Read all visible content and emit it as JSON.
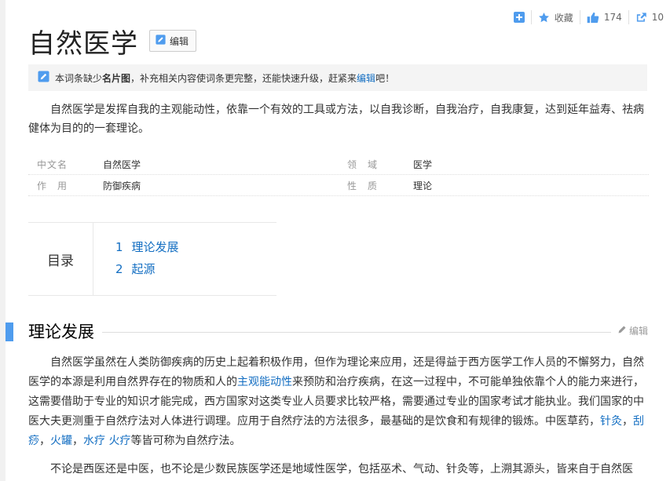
{
  "top_actions": {
    "favorite_label": "收藏",
    "like_count": "174",
    "share_count": "10"
  },
  "title": "自然医学",
  "edit_label": "编辑",
  "notice": {
    "pre": "本词条缺少",
    "bold": "名片图",
    "mid": "，补充相关内容使词条更完整，还能快速升级，赶紧来",
    "link": "编辑",
    "post": "吧！"
  },
  "summary": "自然医学是发挥自我的主观能动性，依靠一个有效的工具或方法，以自我诊断，自我治疗，自我康复，达到延年益寿、祛病健体为目的的一套理论。",
  "basic_info": {
    "rows": [
      {
        "name1": "中文名",
        "value1": "自然医学",
        "name2": "领　域",
        "value2": "医学"
      },
      {
        "name1": "作　用",
        "value1": "防御疾病",
        "name2": "性　质",
        "value2": "理论"
      }
    ]
  },
  "catalog": {
    "title": "目录",
    "items": [
      {
        "index": "1",
        "label": "理论发展"
      },
      {
        "index": "2",
        "label": "起源"
      }
    ]
  },
  "section": {
    "title": "理论发展",
    "edit_label": "编辑"
  },
  "para1": {
    "t1": "自然医学虽然在人类防御疾病的历史上起着积极作用，但作为理论来应用，还是得益于西方医学工作人员的不懈努力，自然医学的本源是利用自然界存在的物质和人的",
    "link1": "主观能动性",
    "t2": "来预防和治疗疾病，在这一过程中，不可能单独依靠个人的能力来进行，这需要借助于专业的知识才能完成，西方国家对这类专业人员要求比较严格，需要通过专业的国家考试才能执业。我们国家的中医大夫更测重于自然疗法对人体进行调理。应用于自然疗法的方法很多，最基础的是饮食和有规律的锻炼。中医草药，",
    "link2": "针灸",
    "t3": "，",
    "link3": "刮痧",
    "t4": "，",
    "link4": "火罐",
    "t5": "，",
    "link5": "水疗",
    "t6": " ",
    "link6": "火疗",
    "t7": "等皆可称为自然疗法。"
  },
  "para2": "不论是西医还是中医，也不论是少数民族医学还是地域性医学，包括巫术、气动、针灸等，上溯其源头，皆来自于自然医"
}
